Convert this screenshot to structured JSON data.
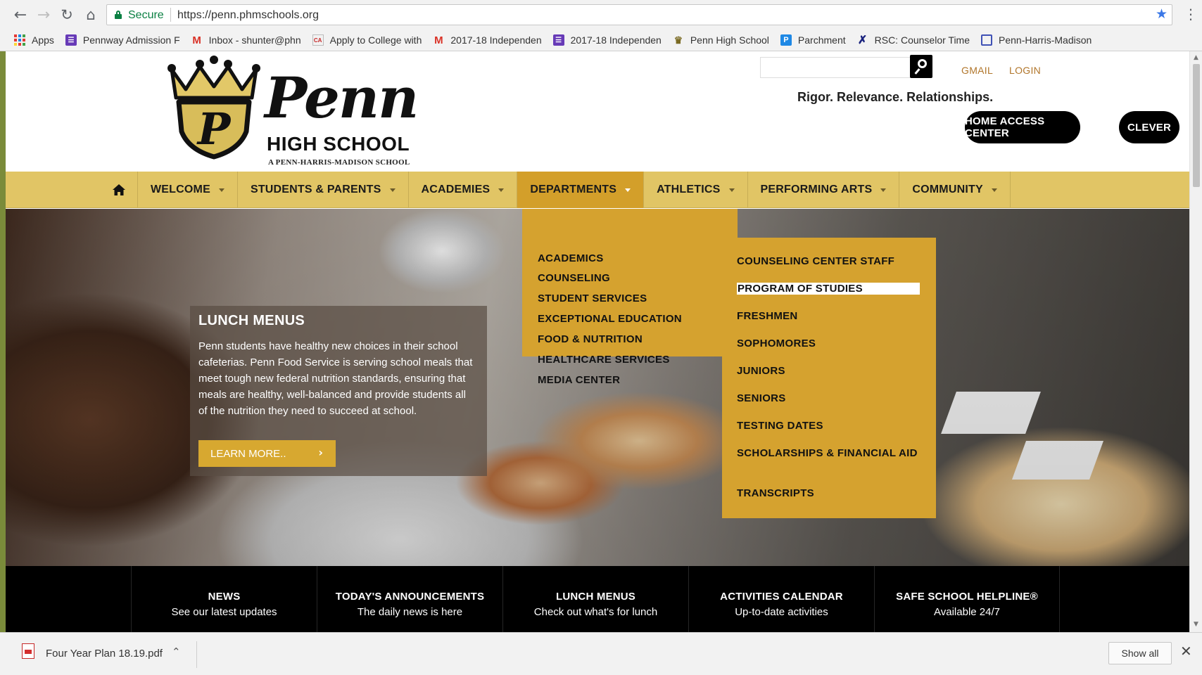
{
  "browser": {
    "secure_label": "Secure",
    "url": "https://penn.phmschools.org",
    "bookmarks": [
      {
        "label": "Apps",
        "icon": "apps-grid-icon"
      },
      {
        "label": "Pennway Admission F",
        "icon": "form-icon"
      },
      {
        "label": "Inbox - shunter@phn",
        "icon": "gmail-icon"
      },
      {
        "label": "Apply to College with",
        "icon": "common-app-icon"
      },
      {
        "label": "2017-18 Independen",
        "icon": "gmail-icon"
      },
      {
        "label": "2017-18 Independen",
        "icon": "form-icon"
      },
      {
        "label": "Penn High School",
        "icon": "penn-shield-icon"
      },
      {
        "label": "Parchment",
        "icon": "parchment-icon"
      },
      {
        "label": "RSC: Counselor Time",
        "icon": "rsc-icon"
      },
      {
        "label": "Penn-Harris-Madison",
        "icon": "phm-icon"
      }
    ]
  },
  "header": {
    "logo_word": "Penn",
    "logo_sub": "HIGH SCHOOL",
    "logo_tag": "A PENN-HARRIS-MADISON SCHOOL",
    "logo_letter": "P",
    "search_value": "",
    "gmail_label": "GMAIL",
    "login_label": "LOGIN",
    "tagline": "Rigor. Relevance. Relationships.",
    "hac_label": "HOME ACCESS CENTER",
    "clever_label": "CLEVER"
  },
  "nav": {
    "items": [
      {
        "label": "WELCOME"
      },
      {
        "label": "STUDENTS & PARENTS"
      },
      {
        "label": "ACADEMIES"
      },
      {
        "label": "DEPARTMENTS"
      },
      {
        "label": "ATHLETICS"
      },
      {
        "label": "PERFORMING ARTS"
      },
      {
        "label": "COMMUNITY"
      }
    ],
    "active": "DEPARTMENTS"
  },
  "departments_menu": [
    "ACADEMICS",
    "COUNSELING",
    "STUDENT SERVICES",
    "EXCEPTIONAL EDUCATION",
    "FOOD & NUTRITION",
    "HEALTHCARE SERVICES",
    "MEDIA CENTER"
  ],
  "counseling_submenu": [
    "COUNSELING CENTER STAFF",
    "PROGRAM OF STUDIES",
    "FRESHMEN",
    "SOPHOMORES",
    "JUNIORS",
    "SENIORS",
    "TESTING DATES",
    "SCHOLARSHIPS & FINANCIAL AID",
    "TRANSCRIPTS"
  ],
  "hero": {
    "title": "LUNCH MENUS",
    "body": "Penn students have healthy new choices in their school cafeterias. Penn Food Service is serving school meals that meet tough new federal nutrition standards, ensuring that meals are healthy, well-balanced and provide students all of the nutrition they need to succeed at school.",
    "button_label": "LEARN MORE.."
  },
  "quicklinks": [
    {
      "title": "NEWS",
      "subtitle": "See our latest updates"
    },
    {
      "title": "TODAY'S ANNOUNCEMENTS",
      "subtitle": "The daily news is here"
    },
    {
      "title": "LUNCH MENUS",
      "subtitle": "Check out what's for lunch"
    },
    {
      "title": "ACTIVITIES CALENDAR",
      "subtitle": "Up-to-date activities"
    },
    {
      "title": "SAFE SCHOOL HELPLINE®",
      "subtitle": "Available 24/7"
    }
  ],
  "downloads": {
    "file_name": "Four Year Plan 18.19.pdf",
    "show_all_label": "Show all"
  },
  "colors": {
    "nav_gold": "#e1c565",
    "menu_gold": "#d5a22f",
    "link_brown": "#b1762b",
    "button_gold": "#d7a830"
  }
}
